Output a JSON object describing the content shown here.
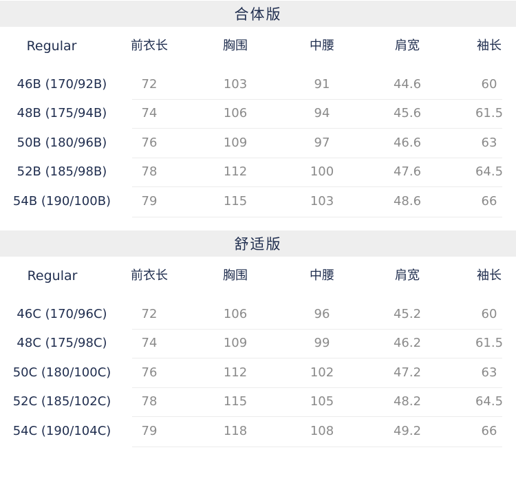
{
  "sections": [
    {
      "title": "合体版",
      "headers": [
        "Regular",
        "前衣长",
        "胸围",
        "中腰",
        "肩宽",
        "袖长"
      ],
      "rows": [
        [
          "46B (170/92B)",
          "72",
          "103",
          "91",
          "44.6",
          "60"
        ],
        [
          "48B (175/94B)",
          "74",
          "106",
          "94",
          "45.6",
          "61.5"
        ],
        [
          "50B (180/96B)",
          "76",
          "109",
          "97",
          "46.6",
          "63"
        ],
        [
          "52B (185/98B)",
          "78",
          "112",
          "100",
          "47.6",
          "64.5"
        ],
        [
          "54B (190/100B)",
          "79",
          "115",
          "103",
          "48.6",
          "66"
        ]
      ]
    },
    {
      "title": "舒适版",
      "headers": [
        "Regular",
        "前衣长",
        "胸围",
        "中腰",
        "肩宽",
        "袖长"
      ],
      "rows": [
        [
          "46C (170/96C)",
          "72",
          "106",
          "96",
          "45.2",
          "60"
        ],
        [
          "48C (175/98C)",
          "74",
          "109",
          "99",
          "46.2",
          "61.5"
        ],
        [
          "50C (180/100C)",
          "76",
          "112",
          "102",
          "47.2",
          "63"
        ],
        [
          "52C (185/102C)",
          "78",
          "115",
          "105",
          "48.2",
          "64.5"
        ],
        [
          "54C (190/104C)",
          "79",
          "118",
          "108",
          "49.2",
          "66"
        ]
      ]
    }
  ],
  "colors": {
    "header_bg": "#eeeeee",
    "title_text": "#1f2d4e",
    "value_text": "#8a8a8a",
    "row_divider": "#ececec"
  }
}
